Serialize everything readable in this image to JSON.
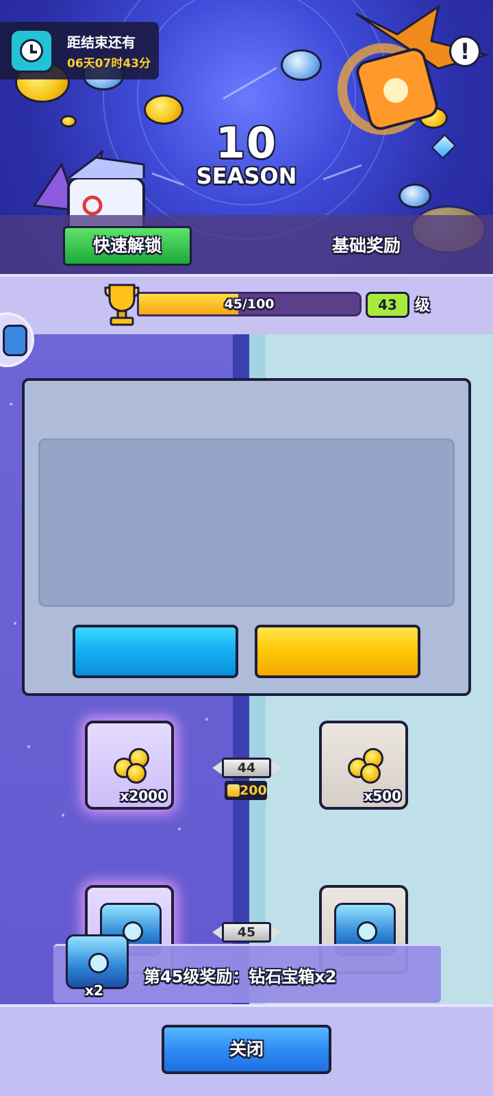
{
  "timer": {
    "label": "距结束还有",
    "value": "06天07时43分"
  },
  "season": {
    "number": "10",
    "word": "SEASON"
  },
  "tabs": {
    "quick_unlock": "快速解锁",
    "basic_rewards": "基础奖励"
  },
  "progress": {
    "text": "45/100",
    "fraction": 0.45,
    "level": "43",
    "level_suffix": "级"
  },
  "rows": [
    {
      "level": "44",
      "premium_qty": "x2000",
      "basic_qty": "x500",
      "cost": "200"
    },
    {
      "level": "45"
    }
  ],
  "toast": {
    "text": "第45级奖励：钻石宝箱x2",
    "qty": "x2"
  },
  "footer": {
    "close_label": "关闭"
  },
  "info_icon": "!",
  "colors": {
    "quick_unlock": "#1cab3a",
    "level_badge": "#a7eb3c",
    "dialog_left_button": "#16b1f5",
    "dialog_right_button": "#ffca0a",
    "close_button": "#2f8cf5"
  }
}
